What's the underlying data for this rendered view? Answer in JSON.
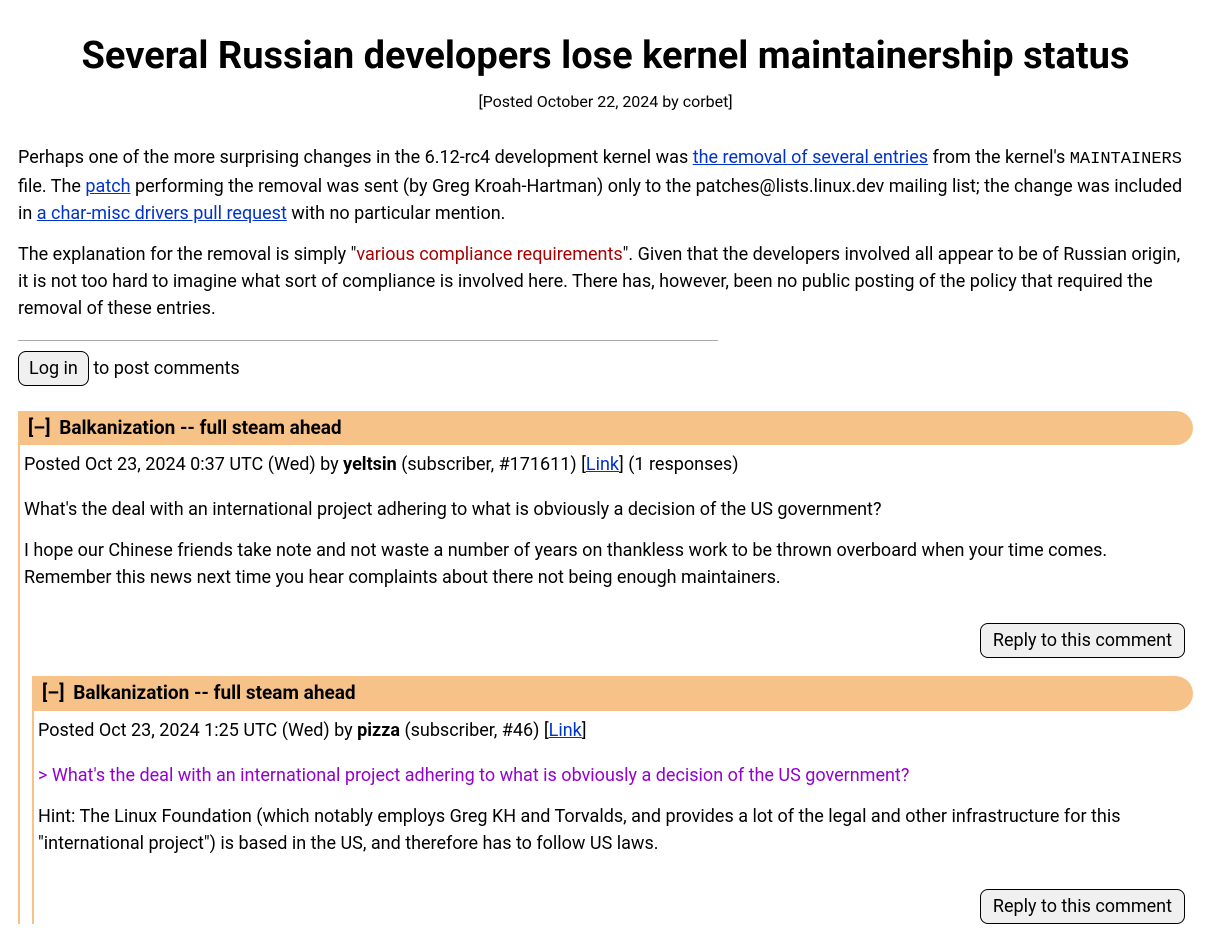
{
  "article": {
    "title": "Several Russian developers lose kernel maintainership status",
    "byline": "[Posted October 22, 2024 by corbet]",
    "p1_a": "Perhaps one of the more surprising changes in the 6.12-rc4 development kernel was ",
    "p1_link1": "the removal of several entries",
    "p1_b": " from the kernel's ",
    "p1_tt": "MAINTAINERS",
    "p1_c": " file. The ",
    "p1_link2": "patch",
    "p1_d": " performing the removal was sent (by Greg Kroah-Hartman) only to the patches@lists.linux.dev mailing list; the change was included in ",
    "p1_link3": "a char-misc drivers pull request",
    "p1_e": " with no particular mention.",
    "p2_a": "The explanation for the removal is simply \"",
    "p2_quote": "various compliance requirements",
    "p2_b": "\". Given that the developers involved all appear to be of Russian origin, it is not too hard to imagine what sort of compliance is involved here. There has, however, been no public posting of the policy that required the removal of these entries."
  },
  "login": {
    "button": "Log in",
    "suffix": " to post comments"
  },
  "comments": [
    {
      "toggle": "[–]",
      "title": "Balkanization -- full steam ahead",
      "meta_a": "Posted Oct 23, 2024 0:37 UTC (Wed) by ",
      "author": "yeltsin",
      "meta_b": " (subscriber, #171611) [",
      "link": "Link",
      "meta_c": "] (1 responses)",
      "body1": "What's the deal with an international project adhering to what is obviously a decision of the US government?",
      "body2": "I hope our Chinese friends take note and not waste a number of years on thankless work to be thrown overboard when your time comes. Remember this news next time you hear complaints about there not being enough maintainers.",
      "reply": "Reply to this comment"
    },
    {
      "toggle": "[–]",
      "title": "Balkanization -- full steam ahead",
      "meta_a": "Posted Oct 23, 2024 1:25 UTC (Wed) by ",
      "author": "pizza",
      "meta_b": " (subscriber, #46) [",
      "link": "Link",
      "meta_c": "]",
      "quoted": "> What's the deal with an international project adhering to what is obviously a decision of the US government?",
      "body1": "Hint: The Linux Foundation (which notably employs Greg KH and Torvalds, and provides a lot of the legal and other infrastructure for this \"international project\") is based in the US, and therefore has to follow US laws.",
      "reply": "Reply to this comment"
    }
  ]
}
